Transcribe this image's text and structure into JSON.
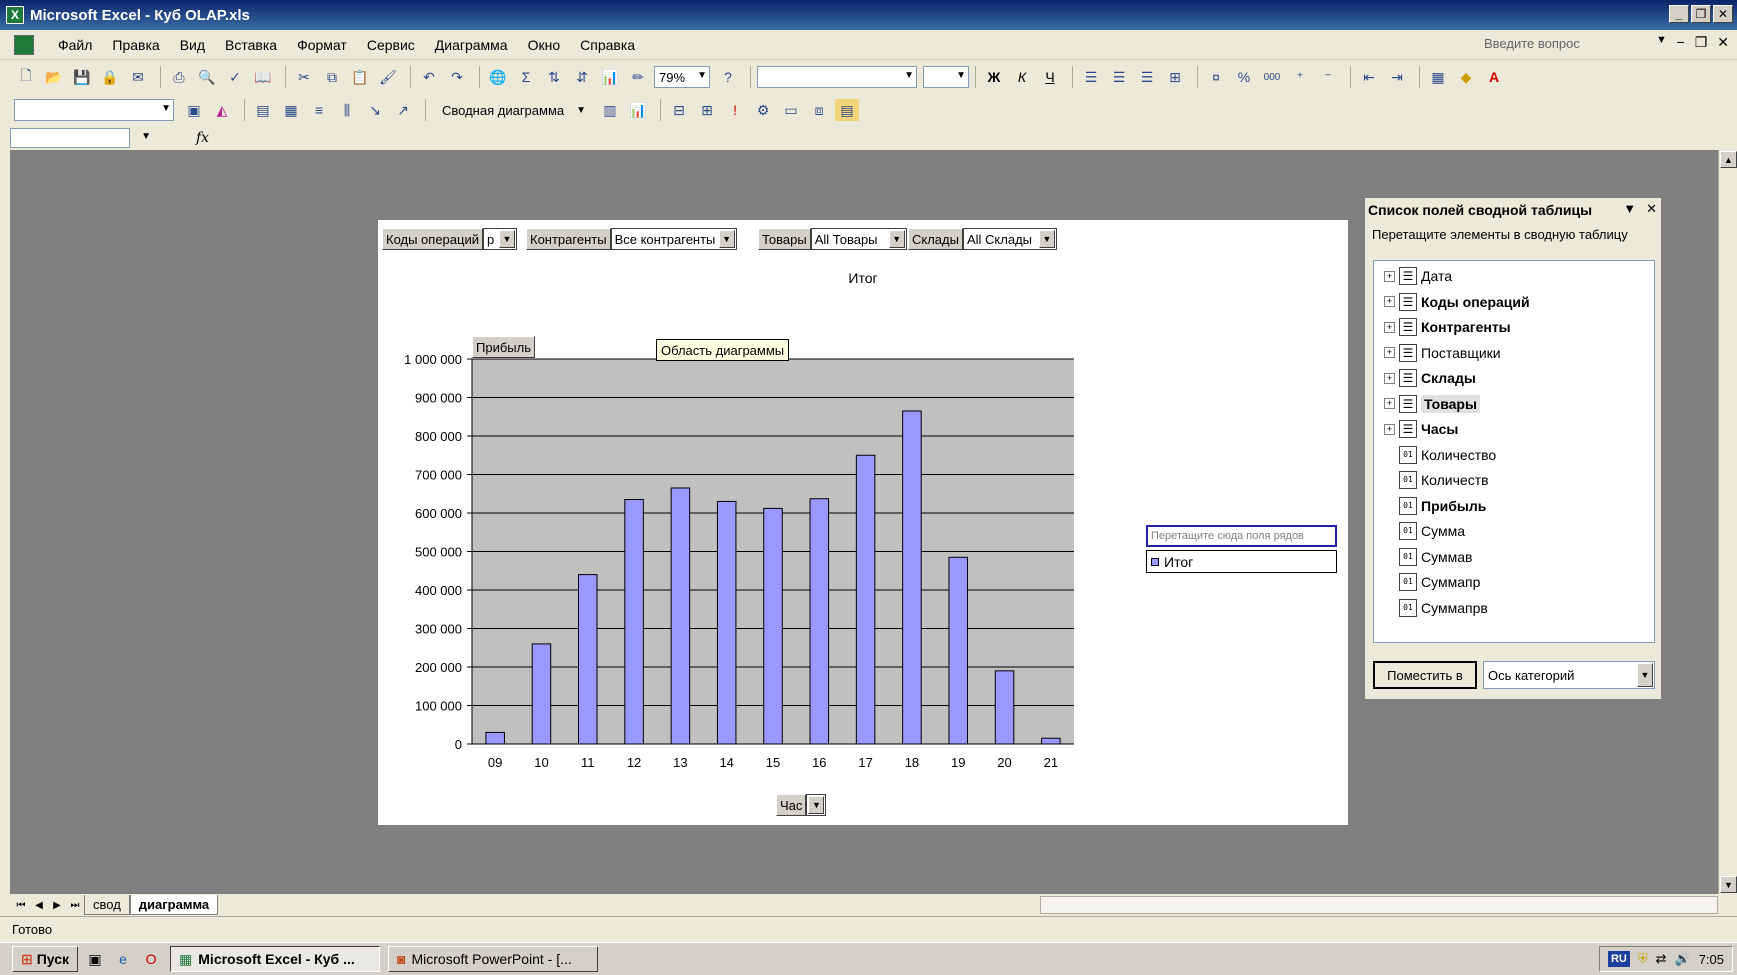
{
  "window": {
    "title": "Microsoft Excel - Куб OLAP.xls",
    "app_icon": "excel-icon"
  },
  "menu": {
    "items": [
      "Файл",
      "Правка",
      "Вид",
      "Вставка",
      "Формат",
      "Сервис",
      "Диаграмма",
      "Окно",
      "Справка"
    ],
    "ask_placeholder": "Введите вопрос"
  },
  "toolbar": {
    "zoom": "79%",
    "pivot_chart_menu": "Сводная диаграмма",
    "bold_label": "Ж",
    "italic_label": "К",
    "underline_label": "Ч",
    "percent_label": "%",
    "thousands_label": "000"
  },
  "formula_bar": {
    "fx_label": "fx"
  },
  "chart": {
    "page_fields": [
      {
        "name": "Коды операций",
        "value": "р"
      },
      {
        "name": "Контрагенты",
        "value": "Все контрагенты"
      },
      {
        "name": "Товары",
        "value": "All Товары"
      },
      {
        "name": "Склады",
        "value": "All Склады"
      }
    ],
    "data_field": "Прибыль",
    "tooltip": "Область диаграммы",
    "series_drop_hint": "Перетащите сюда поля рядов",
    "category_field": "Час",
    "bar_color": "#9999ff",
    "plot_bg": "#c0c0c0"
  },
  "chart_data": {
    "type": "bar",
    "title": "Итог",
    "categories": [
      "09",
      "10",
      "11",
      "12",
      "13",
      "14",
      "15",
      "16",
      "17",
      "18",
      "19",
      "20",
      "21"
    ],
    "series": [
      {
        "name": "Итог",
        "values": [
          30000,
          260000,
          440000,
          635000,
          665000,
          630000,
          612000,
          637000,
          750000,
          865000,
          485000,
          190000,
          15000
        ]
      }
    ],
    "ylim": [
      0,
      1000000
    ],
    "yticks": [
      "0",
      "100 000",
      "200 000",
      "300 000",
      "400 000",
      "500 000",
      "600 000",
      "700 000",
      "800 000",
      "900 000",
      "1 000 000"
    ],
    "grid": true,
    "legend": "right"
  },
  "pivot_field_list": {
    "title": "Список полей сводной таблицы",
    "subtitle": "Перетащите элементы в сводную таблицу",
    "fields": [
      {
        "label": "Дата",
        "kind": "dimension",
        "bold": false
      },
      {
        "label": "Коды операций",
        "kind": "dimension",
        "bold": true
      },
      {
        "label": "Контрагенты",
        "kind": "dimension",
        "bold": true
      },
      {
        "label": "Поставщики",
        "kind": "dimension",
        "bold": false
      },
      {
        "label": "Склады",
        "kind": "dimension",
        "bold": true
      },
      {
        "label": "Товары",
        "kind": "dimension",
        "bold": true,
        "selected": true
      },
      {
        "label": "Часы",
        "kind": "dimension",
        "bold": true
      },
      {
        "label": "Количество",
        "kind": "measure",
        "bold": false
      },
      {
        "label": "Количеств",
        "kind": "measure",
        "bold": false
      },
      {
        "label": "Прибыль",
        "kind": "measure",
        "bold": true
      },
      {
        "label": "Сумма",
        "kind": "measure",
        "bold": false
      },
      {
        "label": "Суммав",
        "kind": "measure",
        "bold": false
      },
      {
        "label": "Суммапр",
        "kind": "measure",
        "bold": false
      },
      {
        "label": "Суммапрв",
        "kind": "measure",
        "bold": false
      }
    ],
    "place_button": "Поместить в",
    "place_target": "Ось категорий"
  },
  "sheets": {
    "tabs": [
      "свод",
      "диаграмма"
    ],
    "active": "диаграмма"
  },
  "status": {
    "text": "Готово"
  },
  "taskbar": {
    "start_label": "Пуск",
    "tasks": [
      "Microsoft Excel - Куб ...",
      "Microsoft PowerPoint - [..."
    ],
    "lang": "RU",
    "clock": "7:05"
  }
}
